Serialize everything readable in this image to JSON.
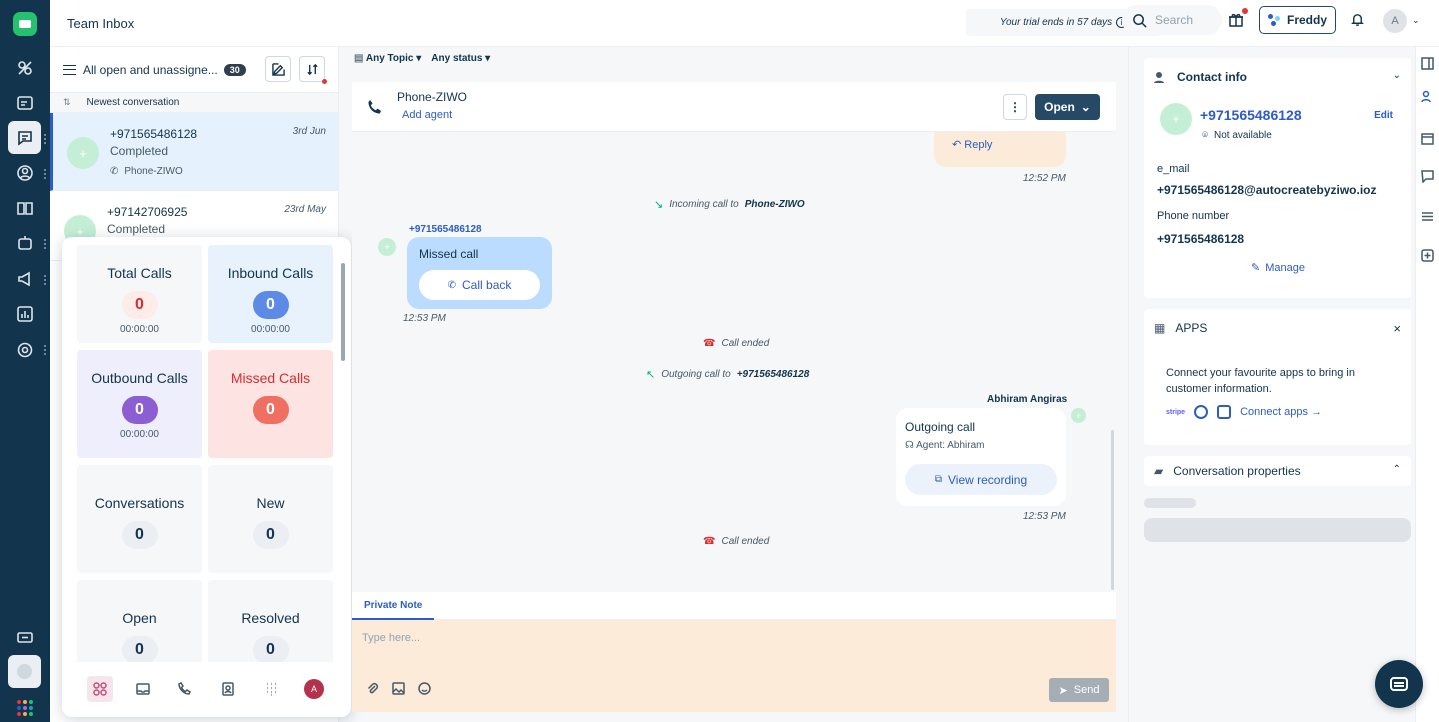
{
  "app": {
    "title": "Team Inbox"
  },
  "header": {
    "trial_text": "Your trial ends in 57 days",
    "search_placeholder": "Search",
    "freddy_label": "Freddy",
    "avatar_initial": "A"
  },
  "rail": {
    "icons": [
      "contacts-icon",
      "inbox-overview-icon",
      "conversations-icon",
      "person-icon",
      "book-icon",
      "bot-icon",
      "megaphone-icon",
      "reports-icon",
      "settings-icon",
      "ticket-icon"
    ],
    "grid_colors": [
      "#e43538",
      "#f8ab59",
      "#25c16f",
      "#2c5cc5",
      "#a66ad6",
      "#12a2bb",
      "#e43538",
      "#f8ab59",
      "#25c16f"
    ]
  },
  "conv_list": {
    "view_label": "All open and unassigne...",
    "count": "30",
    "sort_label": "Newest conversation",
    "items": [
      {
        "number": "+971565486128",
        "status": "Completed",
        "channel": "Phone-ZIWO",
        "date": "3rd Jun"
      },
      {
        "number": "+97142706925",
        "status": "Completed",
        "date": "23rd May"
      }
    ]
  },
  "widget": {
    "tiles": [
      {
        "title": "Total Calls",
        "value": "0",
        "duration": "00:00:00"
      },
      {
        "title": "Inbound Calls",
        "value": "0",
        "duration": "00:00:00"
      },
      {
        "title": "Outbound Calls",
        "value": "0",
        "duration": "00:00:00"
      },
      {
        "title": "Missed Calls",
        "value": "0"
      },
      {
        "title": "Conversations",
        "value": "0"
      },
      {
        "title": "New",
        "value": "0"
      },
      {
        "title": "Open",
        "value": "0"
      },
      {
        "title": "Resolved",
        "value": "0"
      }
    ],
    "footer_icons": [
      "dashboard-icon",
      "inbox-icon",
      "phone-icon",
      "contacts-card-icon",
      "dialpad-icon"
    ],
    "user_initial": "A"
  },
  "filters": {
    "topic": "Any Topic",
    "status": "Any status"
  },
  "conversation": {
    "channel_name": "Phone-ZIWO",
    "add_agent": "Add agent",
    "kebab": "⋮",
    "status_button": "Open",
    "reply_label": "Reply",
    "time_1": "12:52 PM",
    "incoming_prefix": "Incoming call to",
    "incoming_target": "Phone-ZIWO",
    "missed_sender": "+971565486128",
    "missed_title": "Missed call",
    "call_back": "Call back",
    "time_2": "12:53 PM",
    "call_ended_1": "Call ended",
    "outgoing_prefix": "Outgoing call to",
    "outgoing_target": "+971565486128",
    "agent_name": "Abhiram Angiras",
    "outgoing_title": "Outgoing call",
    "agent_line": "Agent: Abhiram",
    "view_recording": "View recording",
    "time_3": "12:53 PM",
    "call_ended_2": "Call ended"
  },
  "compose": {
    "tab": "Private Note",
    "placeholder": "Type here...",
    "send": "Send"
  },
  "contact_info": {
    "title": "Contact info",
    "number": "+971565486128",
    "edit": "Edit",
    "availability": "Not available",
    "email_label": "e_mail",
    "email_value": "+971565486128@autocreatebyziwo.ioz",
    "phone_label": "Phone number",
    "phone_value": "+971565486128",
    "manage": "Manage"
  },
  "apps": {
    "title": "APPS",
    "close": "×",
    "description": "Connect your favourite apps to bring in customer information.",
    "stripe": "stripe",
    "connect": "Connect apps →"
  },
  "conv_props": {
    "title": "Conversation properties"
  },
  "colors": {
    "rail_bg": "#12344d",
    "accent_blue": "#2c5cc5",
    "open_button": "#264966",
    "missed_red": "#d72d30",
    "inbound_blue": "#5c8ae6",
    "outbound_purple": "#8b5fd1",
    "missed_tile_pink": "#f06f63"
  }
}
